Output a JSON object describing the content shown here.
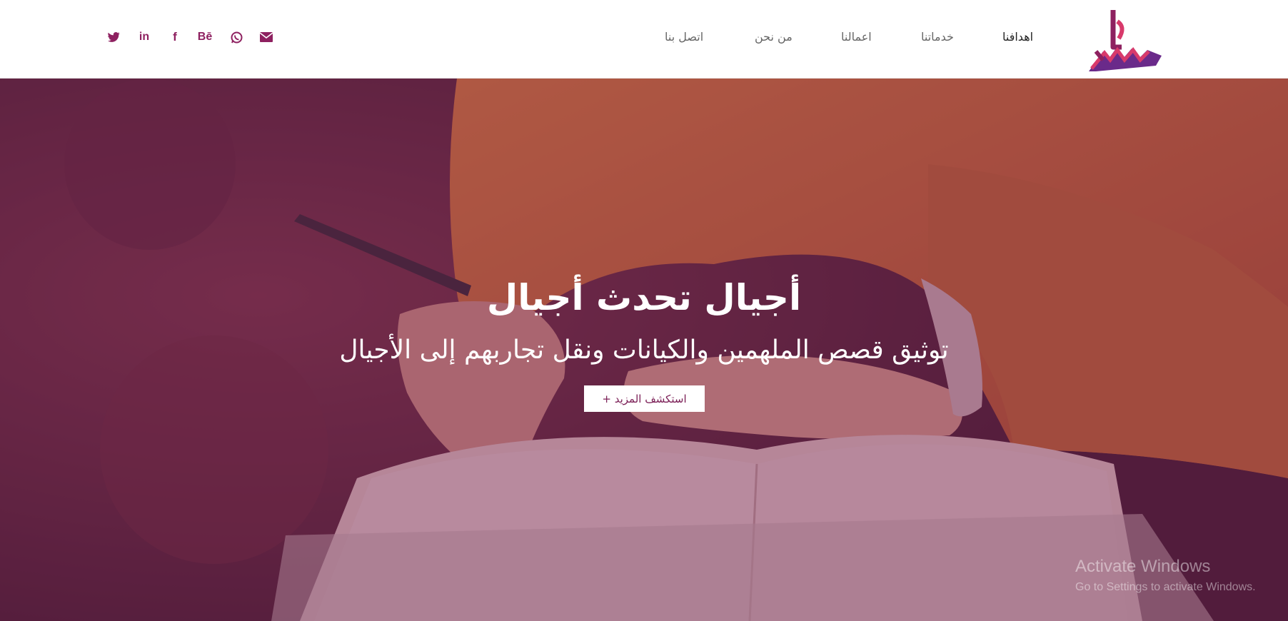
{
  "brand": {
    "primary_color": "#8e2160",
    "secondary_color": "#d83a6b",
    "accent_color": "#6a2a8a",
    "logo_icon": "brand-logo-icon"
  },
  "nav": {
    "items": [
      {
        "label": "اهدافنا",
        "active": true
      },
      {
        "label": "خدماتنا",
        "active": false
      },
      {
        "label": "اعمالنا",
        "active": false
      },
      {
        "label": "من نحن",
        "active": false
      },
      {
        "label": "اتصل بنا",
        "active": false
      }
    ]
  },
  "social": {
    "items": [
      {
        "name": "email",
        "icon": "envelope-icon",
        "glyph": "✉"
      },
      {
        "name": "whatsapp",
        "icon": "whatsapp-icon",
        "glyph": "◎"
      },
      {
        "name": "behance",
        "icon": "behance-icon",
        "glyph": "Bē"
      },
      {
        "name": "facebook",
        "icon": "facebook-icon",
        "glyph": "f"
      },
      {
        "name": "linkedin",
        "icon": "linkedin-icon",
        "glyph": "in"
      },
      {
        "name": "twitter",
        "icon": "twitter-icon",
        "glyph": "🐦"
      }
    ]
  },
  "hero": {
    "title": "أجيال تحدث أجيال",
    "subtitle": "توثيق قصص الملهمين والكيانات ونقل تجاربهم إلى الأجيال",
    "cta_label": "استكشف المزيد +",
    "overlay_color": "#701c50"
  },
  "os_watermark": {
    "line1": "Activate Windows",
    "line2": "Go to Settings to activate Windows."
  }
}
